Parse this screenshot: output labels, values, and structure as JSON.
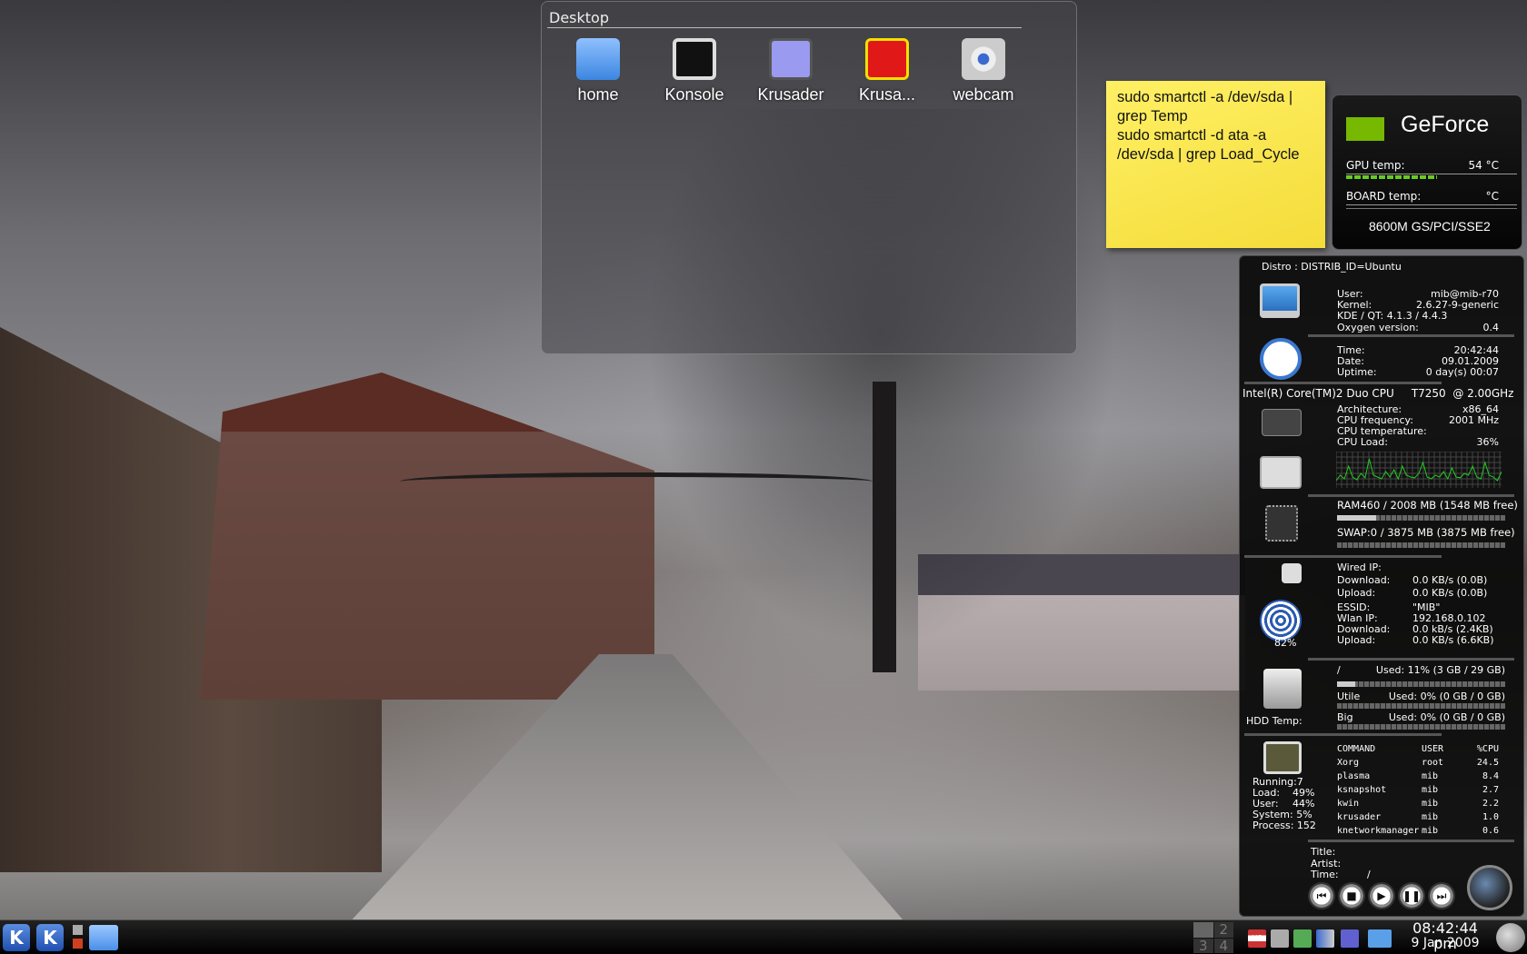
{
  "folder_view": {
    "title": "Desktop",
    "icons": [
      {
        "label": "home",
        "icon": "home-folder-icon"
      },
      {
        "label": "Konsole",
        "icon": "terminal-icon"
      },
      {
        "label": "Krusader",
        "icon": "krusader-icon"
      },
      {
        "label": "Krusa...",
        "icon": "krusader-root-icon"
      },
      {
        "label": "webcam",
        "icon": "camera-icon"
      }
    ]
  },
  "note": {
    "lines": [
      "sudo smartctl -a /dev/sda |",
      "grep Temp",
      "sudo smartctl -d ata -a",
      "/dev/sda | grep Load_Cycle"
    ]
  },
  "geforce": {
    "title": "GeForce",
    "gpu_label": "GPU temp:",
    "gpu_value": "54  °C",
    "gpu_level": 0.55,
    "board_label": "BOARD temp:",
    "board_value": "°C",
    "model": "8600M GS/PCI/SSE2"
  },
  "sysmon": {
    "distro": "Distro :  DISTRIB_ID=Ubuntu",
    "system": [
      [
        "User:",
        "mib@mib-r70"
      ],
      [
        "Kernel:",
        "2.6.27-9-generic"
      ],
      [
        "KDE / QT:  4.1.3 / 4.4.3",
        ""
      ],
      [
        "Oxygen version:",
        "0.4"
      ]
    ],
    "time": [
      [
        "Time:",
        "20:42:44"
      ],
      [
        "Date:",
        "09.01.2009"
      ],
      [
        "Uptime:",
        "0 day(s)  00:07"
      ]
    ],
    "cpu_title": "Intel(R) Core(TM)2 Duo CPU     T7250  @ 2.00GHz",
    "cpu": [
      [
        "Architecture:",
        "x86_64"
      ],
      [
        "CPU frequency:",
        "2001 MHz"
      ],
      [
        "CPU temperature:",
        ""
      ],
      [
        "CPU Load:",
        "36%"
      ]
    ],
    "cpu_history": [
      20,
      35,
      25,
      60,
      30,
      22,
      40,
      28,
      80,
      35,
      30,
      25,
      45,
      30,
      50,
      25,
      60,
      35,
      30,
      28,
      40,
      70,
      30,
      25,
      35,
      30,
      45,
      25,
      55,
      30,
      28,
      40,
      35,
      60,
      30,
      25,
      70,
      35,
      30,
      20,
      45
    ],
    "ram": "RAM460 / 2008 MB (1548 MB free)",
    "ram_used": 0.23,
    "swap": "SWAP:0 / 3875 MB (3875 MB free)",
    "swap_used": 0,
    "net": [
      [
        "Wired IP:",
        ""
      ],
      [
        "Download:",
        "0.0 KB/s (0.0B)"
      ],
      [
        "Upload:",
        "0.0 KB/s (0.0B)"
      ],
      [
        "ESSID:",
        "\"MIB\""
      ],
      [
        "Wlan IP:",
        "192.168.0.102"
      ],
      [
        "Download:",
        "0.0 kB/s (2.4KB)"
      ],
      [
        "Upload:",
        "0.0 KB/s (6.6KB)"
      ]
    ],
    "wifi_signal": "82%",
    "disks": [
      {
        "mount": "/",
        "usage": "Used: 11% (3 GB / 29 GB)",
        "used": 0.11
      },
      {
        "mount": "Utile",
        "usage": "Used: 0% (0 GB / 0 GB)",
        "used": 0
      },
      {
        "mount": "Big",
        "usage": "Used: 0% (0 GB / 0 GB)",
        "used": 0
      }
    ],
    "hdd_temp": "HDD Temp:",
    "proc_headers": [
      "COMMAND",
      "USER",
      "%CPU"
    ],
    "procs": [
      [
        "Xorg",
        "root",
        "24.5"
      ],
      [
        "plasma",
        "mib",
        "8.4"
      ],
      [
        "ksnapshot",
        "mib",
        "2.7"
      ],
      [
        "kwin",
        "mib",
        "2.2"
      ],
      [
        "krusader",
        "mib",
        "1.0"
      ],
      [
        "knetworkmanager",
        "mib",
        "0.6"
      ]
    ],
    "stats": [
      [
        "Running:7",
        ""
      ],
      [
        "Load:",
        "49%"
      ],
      [
        "User:",
        "44%"
      ],
      [
        "System: 5%",
        ""
      ],
      [
        "Process: 152",
        ""
      ]
    ],
    "player": {
      "title": "Title:",
      "artist": "Artist:",
      "time": "Time:",
      "time_value": "/"
    }
  },
  "taskbar": {
    "pager": [
      "",
      "2",
      "3",
      "4"
    ],
    "clock_time": "08:42:44 pm",
    "clock_date": "9 Jan 2009",
    "kb_layout": "US"
  }
}
